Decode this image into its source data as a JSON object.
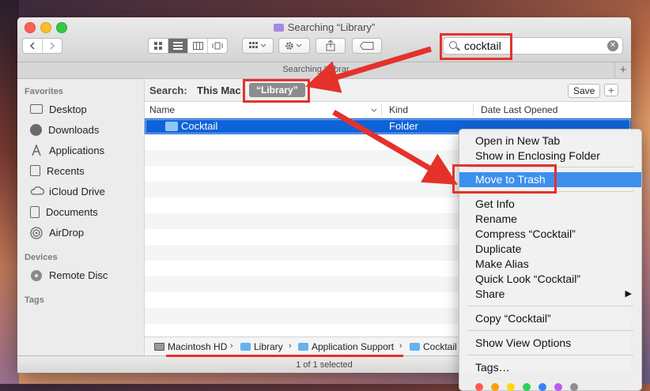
{
  "window": {
    "title": "Searching “Library”"
  },
  "toolbar": {
    "back_icon": "chevron-left-icon",
    "forward_icon": "chevron-right-icon"
  },
  "search": {
    "value": "cocktail"
  },
  "tabbar": {
    "label": "Searching “Librar"
  },
  "scope": {
    "label": "Search:",
    "this_mac": "This Mac",
    "library": "“Library”",
    "save": "Save",
    "add": "+"
  },
  "columns": {
    "name": "Name",
    "kind": "Kind",
    "date": "Date Last Opened"
  },
  "sidebar": {
    "favorites_header": "Favorites",
    "favorites": [
      {
        "label": "Desktop",
        "icon": "desktop-icon"
      },
      {
        "label": "Downloads",
        "icon": "downloads-icon"
      },
      {
        "label": "Applications",
        "icon": "applications-icon"
      },
      {
        "label": "Recents",
        "icon": "recents-icon"
      },
      {
        "label": "iCloud Drive",
        "icon": "icloud-icon"
      },
      {
        "label": "Documents",
        "icon": "documents-icon"
      },
      {
        "label": "AirDrop",
        "icon": "airdrop-icon"
      }
    ],
    "devices_header": "Devices",
    "devices": [
      {
        "label": "Remote Disc",
        "icon": "disc-icon"
      }
    ],
    "tags_header": "Tags"
  },
  "results": [
    {
      "name": "Cocktail",
      "kind": "Folder"
    }
  ],
  "path": {
    "items": [
      "Macintosh HD",
      "Library",
      "Application Support",
      "Cocktail"
    ],
    "separator": "›"
  },
  "status": "1 of 1 selected",
  "context_menu": {
    "items": [
      "Open in New Tab",
      "Show in Enclosing Folder",
      "Move to Trash",
      "Get Info",
      "Rename",
      "Compress “Cocktail”",
      "Duplicate",
      "Make Alias",
      "Quick Look “Cocktail”",
      "Share",
      "Copy “Cocktail”",
      "Show View Options",
      "Tags…"
    ],
    "submenu_arrow": "▶",
    "highlighted": "Move to Trash"
  },
  "colors": {
    "highlight": "#3d8fee",
    "selection": "#0f63d8",
    "annotation": "#e4322b",
    "tag_colors": [
      "#ff5a52",
      "#ff9f0a",
      "#ffd60a",
      "#30d158",
      "#3b82f6",
      "#bf5af2",
      "#8e8e93"
    ]
  }
}
